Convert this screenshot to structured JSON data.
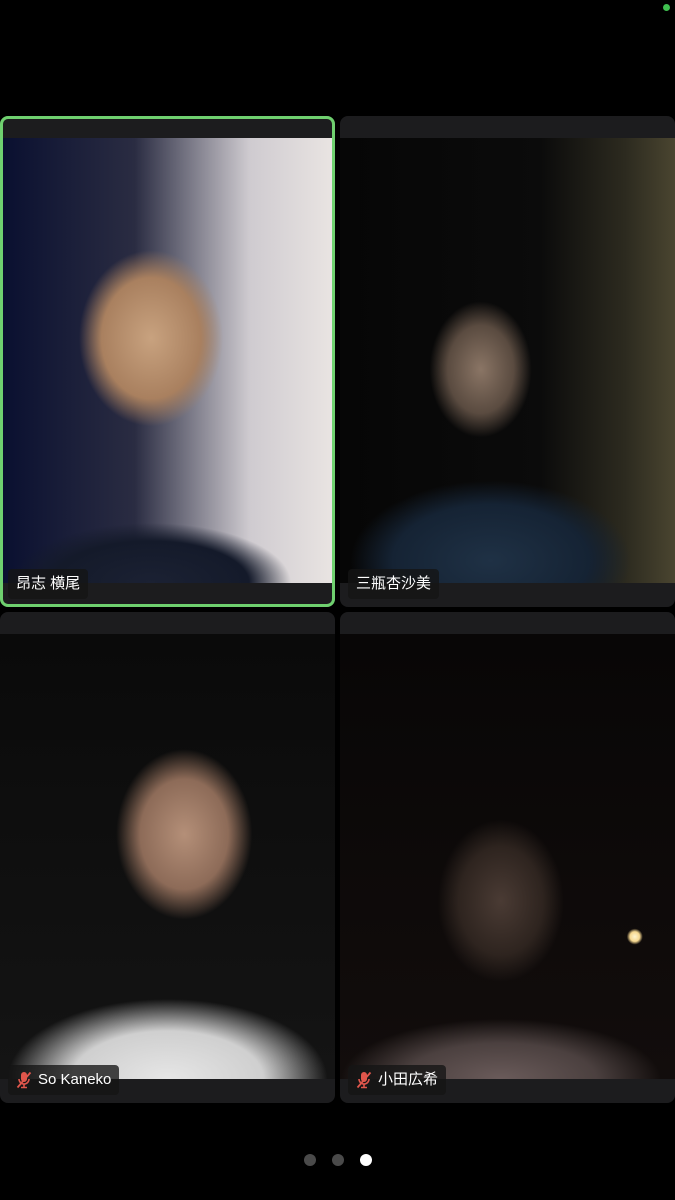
{
  "participants": [
    {
      "name": "昂志 横尾",
      "muted": false,
      "active_speaker": true
    },
    {
      "name": "三瓶杏沙美",
      "muted": false,
      "active_speaker": false
    },
    {
      "name": "So Kaneko",
      "muted": true,
      "active_speaker": false
    },
    {
      "name": "小田広希",
      "muted": true,
      "active_speaker": false
    }
  ],
  "pagination": {
    "total_pages": 3,
    "current_page": 3
  },
  "colors": {
    "active_speaker_border": "#6fd06f",
    "muted_icon": "#e0564c",
    "status_dot": "#3fbf4f"
  },
  "icons": {
    "muted_mic": "mic-muted-icon"
  }
}
